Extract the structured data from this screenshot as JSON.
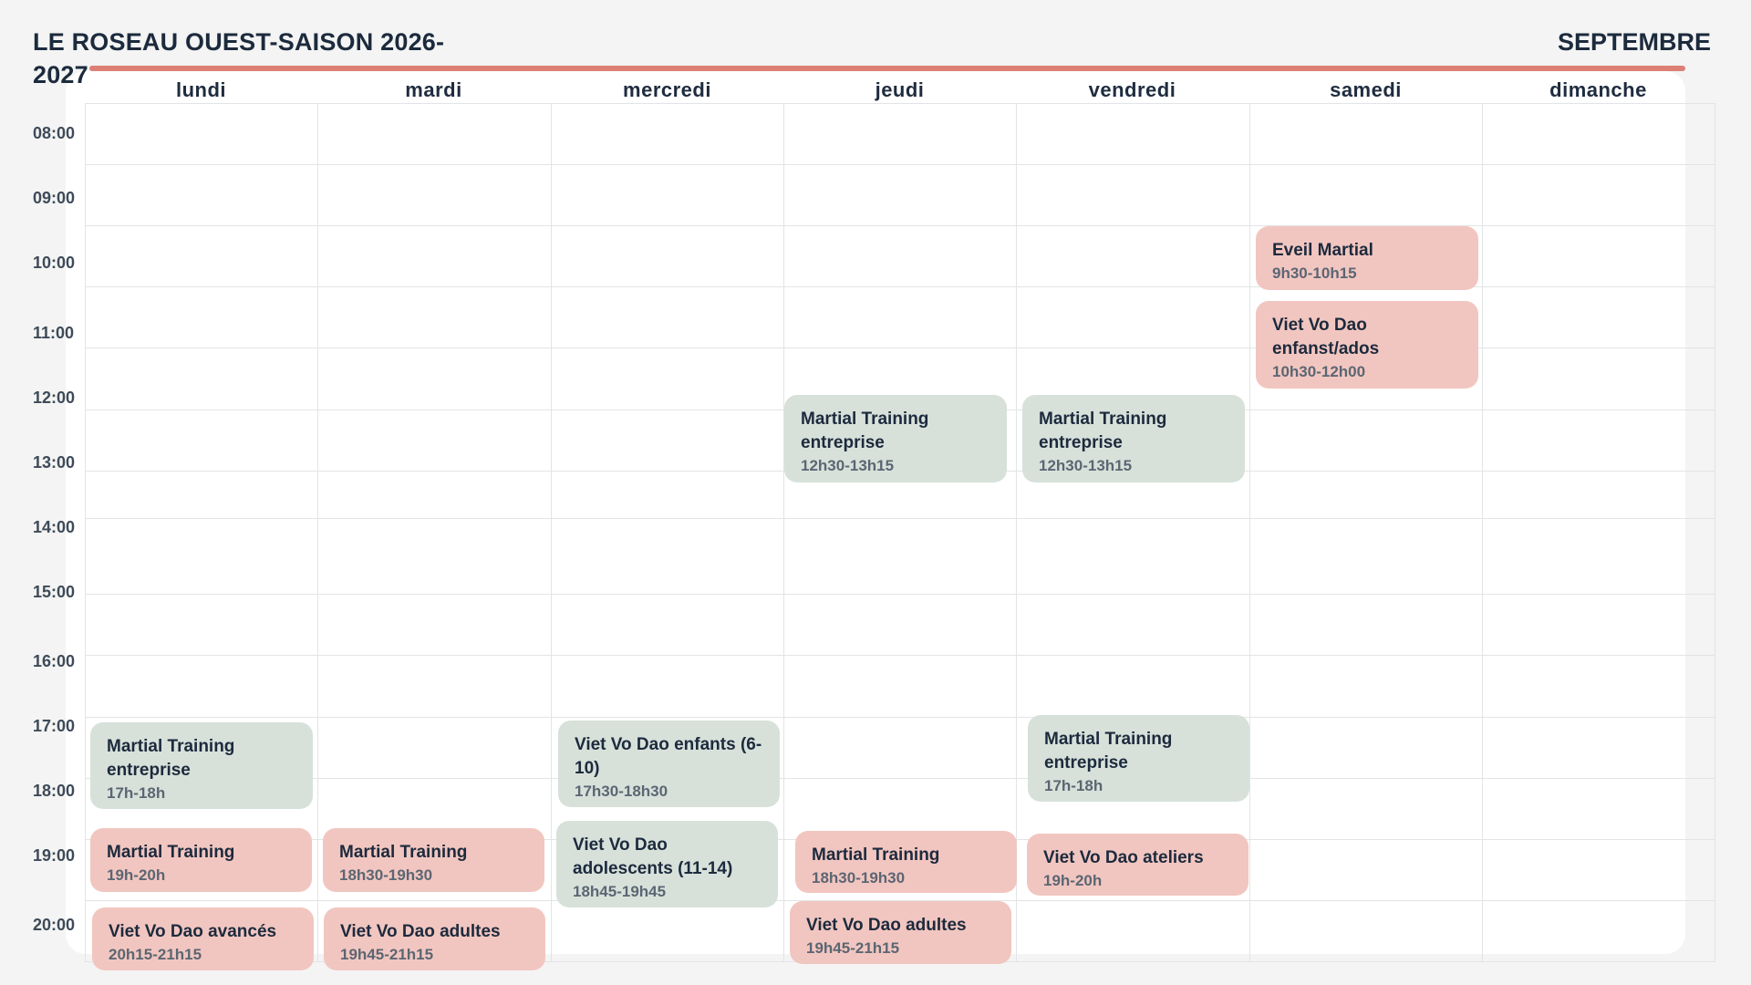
{
  "header": {
    "title": "LE ROSEAU OUEST-SAISON 2026-2027",
    "month": "SEPTEMBRE"
  },
  "colors": {
    "accent": "#dc8076",
    "event_red": "#f2c6c0",
    "event_green": "#d7e1da"
  },
  "days": [
    "lundi",
    "mardi",
    "mercredi",
    "jeudi",
    "vendredi",
    "samedi",
    "dimanche"
  ],
  "times": [
    "08:00",
    "09:00",
    "10:00",
    "11:00",
    "12:00",
    "13:00",
    "14:00",
    "15:00",
    "16:00",
    "17:00",
    "18:00",
    "19:00",
    "20:00"
  ],
  "events": [
    {
      "day": "samedi",
      "color": "red",
      "title": "Eveil Martial",
      "time": "9h30-10h15"
    },
    {
      "day": "samedi",
      "color": "red",
      "title": "Viet Vo Dao enfanst/ados",
      "time": "10h30-12h00"
    },
    {
      "day": "jeudi",
      "color": "green",
      "title": "Martial Training entreprise",
      "time": "12h30-13h15"
    },
    {
      "day": "vendredi",
      "color": "green",
      "title": "Martial Training entreprise",
      "time": "12h30-13h15"
    },
    {
      "day": "lundi",
      "color": "green",
      "title": "Martial Training entreprise",
      "time": "17h-18h"
    },
    {
      "day": "mercredi",
      "color": "green",
      "title": "Viet Vo Dao enfants (6-10)",
      "time": "17h30-18h30"
    },
    {
      "day": "vendredi",
      "color": "green",
      "title": "Martial Training entreprise",
      "time": "17h-18h"
    },
    {
      "day": "lundi",
      "color": "red",
      "title": "Martial Training",
      "time": "19h-20h"
    },
    {
      "day": "mardi",
      "color": "red",
      "title": "Martial Training",
      "time": "18h30-19h30"
    },
    {
      "day": "mercredi",
      "color": "green",
      "title": "Viet Vo Dao adolescents (11-14)",
      "time": "18h45-19h45"
    },
    {
      "day": "jeudi",
      "color": "red",
      "title": "Martial Training",
      "time": "18h30-19h30"
    },
    {
      "day": "vendredi",
      "color": "red",
      "title": "Viet Vo Dao ateliers",
      "time": "19h-20h"
    },
    {
      "day": "lundi",
      "color": "red",
      "title": "Viet Vo Dao avancés",
      "time": "20h15-21h15"
    },
    {
      "day": "mardi",
      "color": "red",
      "title": "Viet Vo Dao adultes",
      "time": "19h45-21h15"
    },
    {
      "day": "jeudi",
      "color": "red",
      "title": "Viet Vo Dao adultes",
      "time": "19h45-21h15"
    }
  ]
}
